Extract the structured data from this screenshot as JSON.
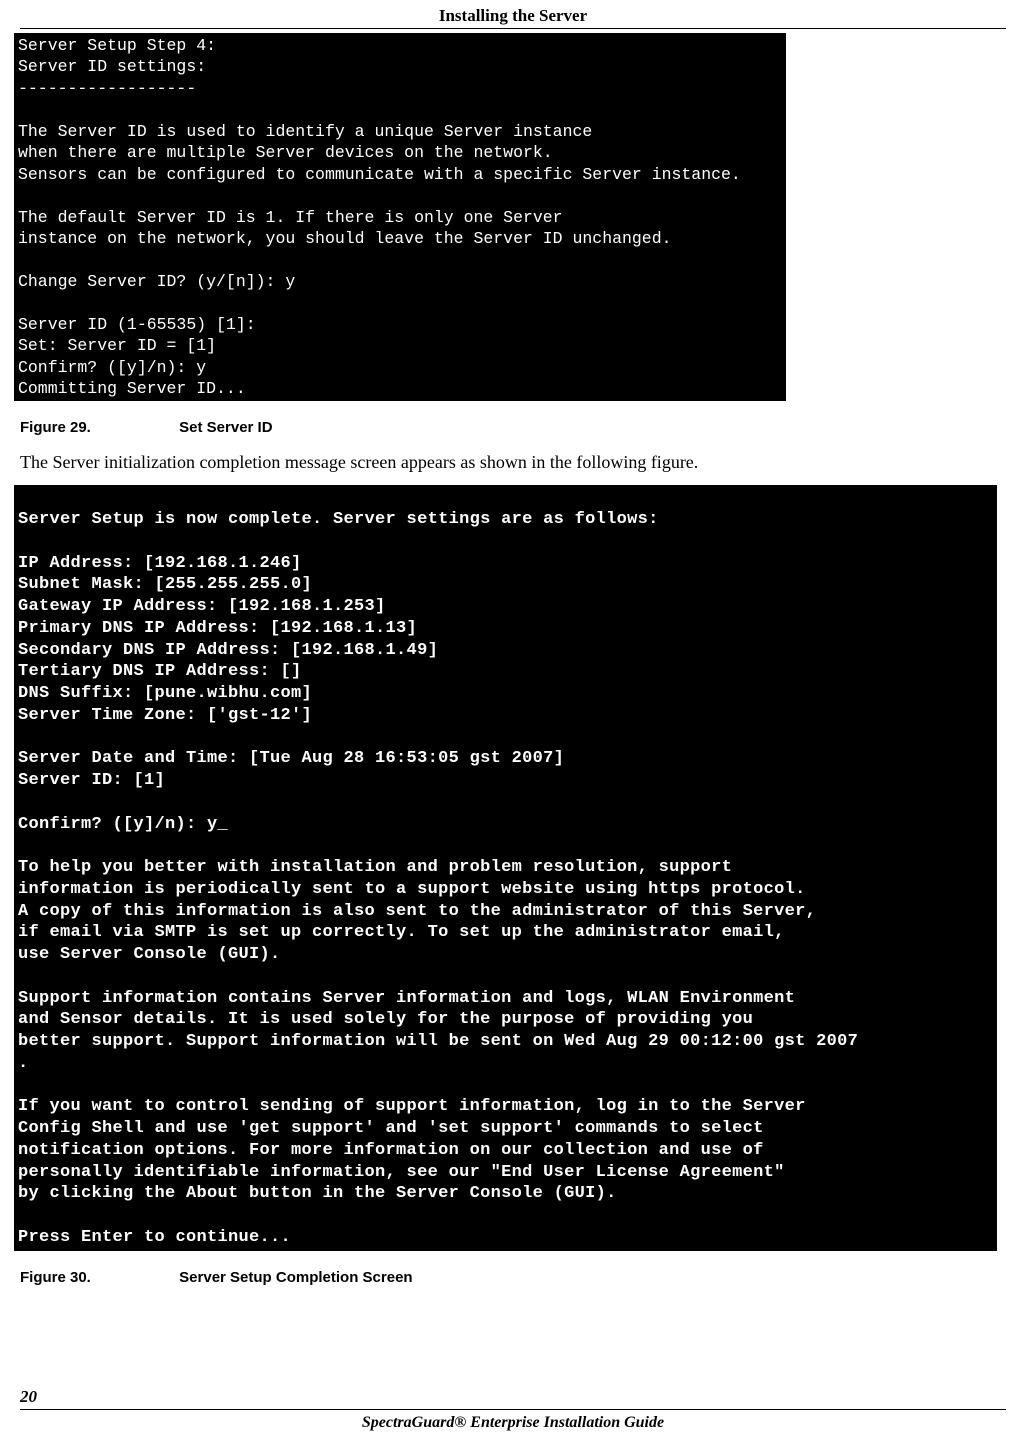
{
  "header": {
    "title": "Installing the Server"
  },
  "terminal1_text": "Server Setup Step 4:\nServer ID settings:\n------------------\n\nThe Server ID is used to identify a unique Server instance\nwhen there are multiple Server devices on the network.\nSensors can be configured to communicate with a specific Server instance.\n\nThe default Server ID is 1. If there is only one Server\ninstance on the network, you should leave the Server ID unchanged.\n\nChange Server ID? (y/[n]): y\n\nServer ID (1-65535) [1]:\nSet: Server ID = [1]\nConfirm? ([y]/n): y\nCommitting Server ID...",
  "figure29": {
    "num": "Figure  29.",
    "caption": "Set Server ID"
  },
  "body_text": "The Server initialization completion message screen appears as shown in the following figure.",
  "terminal2_text": "\nServer Setup is now complete. Server settings are as follows:\n\nIP Address: [192.168.1.246]\nSubnet Mask: [255.255.255.0]\nGateway IP Address: [192.168.1.253]\nPrimary DNS IP Address: [192.168.1.13]\nSecondary DNS IP Address: [192.168.1.49]\nTertiary DNS IP Address: []\nDNS Suffix: [pune.wibhu.com]\nServer Time Zone: ['gst-12']\n\nServer Date and Time: [Tue Aug 28 16:53:05 gst 2007]\nServer ID: [1]\n\nConfirm? ([y]/n): y_\n\nTo help you better with installation and problem resolution, support\ninformation is periodically sent to a support website using https protocol.\nA copy of this information is also sent to the administrator of this Server,\nif email via SMTP is set up correctly. To set up the administrator email,\nuse Server Console (GUI).\n\nSupport information contains Server information and logs, WLAN Environment\nand Sensor details. It is used solely for the purpose of providing you\nbetter support. Support information will be sent on Wed Aug 29 00:12:00 gst 2007\n.\n\nIf you want to control sending of support information, log in to the Server\nConfig Shell and use 'get support' and 'set support' commands to select\nnotification options. For more information on our collection and use of\npersonally identifiable information, see our \"End User License Agreement\"\nby clicking the About button in the Server Console (GUI).\n\nPress Enter to continue...\n",
  "figure30": {
    "num": "Figure  30.",
    "caption": "Server Setup Completion Screen"
  },
  "footer": {
    "page_number": "20",
    "guide": "SpectraGuard® Enterprise Installation Guide"
  }
}
